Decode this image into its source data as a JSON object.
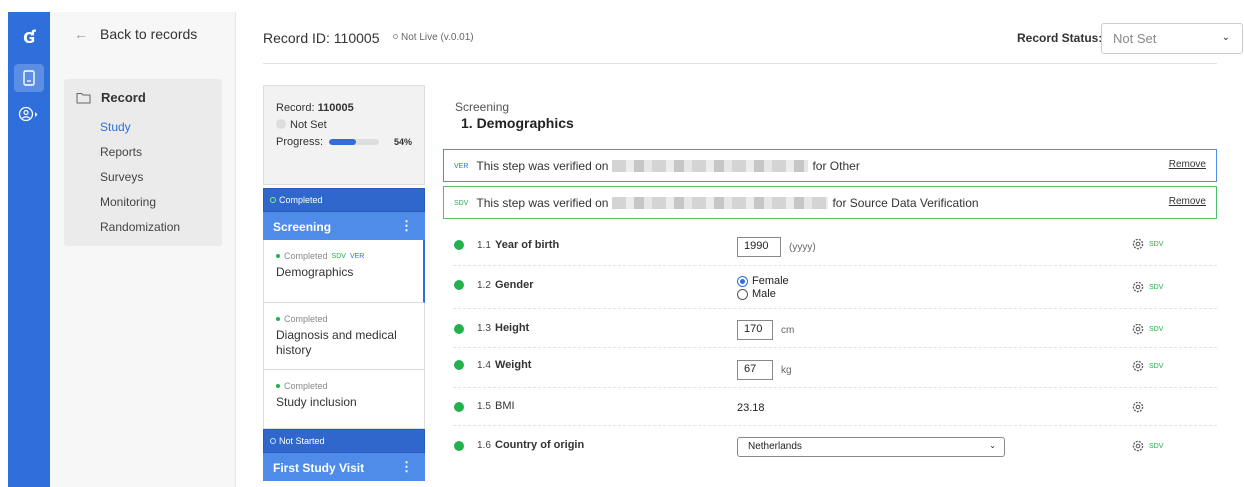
{
  "rail": {
    "logo": "ʛ"
  },
  "nav": {
    "back_label": "Back to records",
    "section": "Record",
    "items": [
      {
        "label": "Study",
        "active": true
      },
      {
        "label": "Reports"
      },
      {
        "label": "Surveys"
      },
      {
        "label": "Monitoring"
      },
      {
        "label": "Randomization"
      }
    ]
  },
  "header": {
    "record_id": "Record ID: 110005",
    "live_status": "Not Live (v.0.01)",
    "record_status_label": "Record Status:",
    "record_status_value": "Not Set"
  },
  "summary": {
    "record_label": "Record:",
    "record_number": "110005",
    "status": "Not Set",
    "progress_label": "Progress:",
    "progress_percent": 54,
    "progress_text": "54%"
  },
  "phases": [
    {
      "status": "Completed",
      "title": "Screening",
      "steps": [
        {
          "status": "Completed",
          "name": "Demographics",
          "sdv": "SDV",
          "ver": "VER",
          "active": true
        },
        {
          "status": "Completed",
          "name": "Diagnosis and medical history"
        },
        {
          "status": "Completed",
          "name": "Study inclusion"
        }
      ]
    },
    {
      "status": "Not Started",
      "title": "First Study Visit",
      "steps": []
    }
  ],
  "form": {
    "breadcrumb": "Screening",
    "title": "1. Demographics",
    "verifications": [
      {
        "tag": "VER",
        "prefix": "This step was verified on",
        "suffix": "for Other",
        "remove": "Remove"
      },
      {
        "tag": "SDV",
        "prefix": "This step was verified on",
        "suffix": "for Source Data Verification",
        "remove": "Remove"
      }
    ],
    "fields": [
      {
        "number": "1.1",
        "label": "Year of birth",
        "value": "1990",
        "unit": "(yyyy)",
        "sdv": "SDV"
      },
      {
        "number": "1.2",
        "label": "Gender",
        "options": [
          "Female",
          "Male"
        ],
        "selected": "Female",
        "sdv": "SDV"
      },
      {
        "number": "1.3",
        "label": "Height",
        "value": "170",
        "unit": "cm",
        "sdv": "SDV"
      },
      {
        "number": "1.4",
        "label": "Weight",
        "value": "67",
        "unit": "kg",
        "sdv": "SDV"
      },
      {
        "number": "1.5",
        "label": "BMI",
        "value": "23.18"
      },
      {
        "number": "1.6",
        "label": "Country of origin",
        "value": "Netherlands",
        "sdv": "SDV"
      }
    ]
  },
  "colors": {
    "accent": "#2f6fdc",
    "completed": "#22b14c",
    "phase": "#4f8be8"
  },
  "icons": {
    "back": "arrow-left-icon",
    "folder": "folder-icon",
    "settings": "gear-icon",
    "chevron": "chevron-down-icon"
  }
}
